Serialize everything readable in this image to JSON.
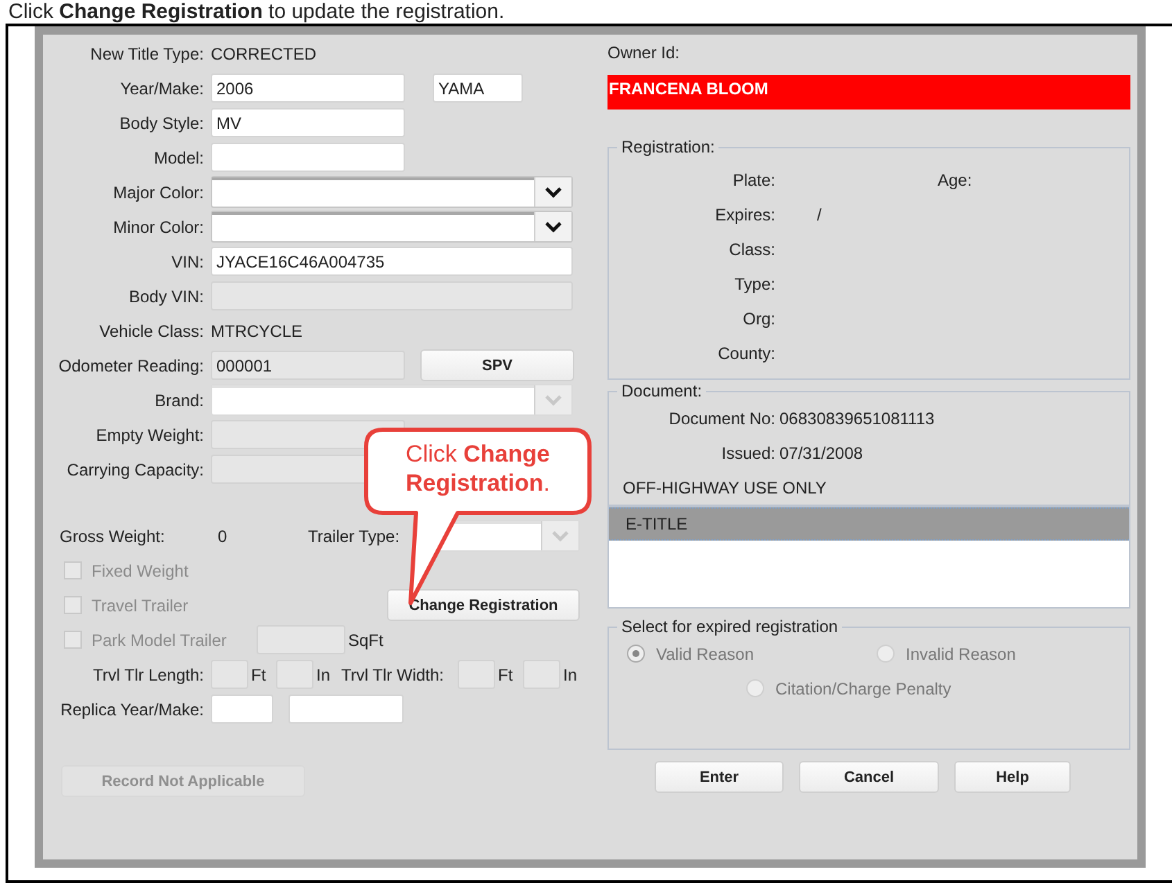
{
  "instruction": "Click **Change Registration** to update the registration.",
  "vehicle": {
    "fields": [
      {
        "kind": "static",
        "label": "New Title Type:",
        "value": "CORRECTED"
      },
      {
        "kind": "short_input",
        "label": "Year/Make:",
        "value": "2006",
        "extra_value": "YAMA"
      },
      {
        "kind": "short_input",
        "label": "Body Style:",
        "value": "MV"
      },
      {
        "kind": "short_input",
        "label": "Model:"
      },
      {
        "kind": "select",
        "label": "Major Color:",
        "disabled": false
      },
      {
        "kind": "select",
        "label": "Minor Color:",
        "disabled": false
      },
      {
        "kind": "long_input",
        "label": "VIN:",
        "value": "JYACE16C46A004735"
      },
      {
        "kind": "long_readonly",
        "label": "Body VIN:"
      },
      {
        "kind": "static",
        "label": "Vehicle Class:",
        "value": "MTRCYCLE"
      },
      {
        "kind": "short_readonly",
        "label": "Odometer Reading:",
        "value": "000001",
        "button": "SPV"
      },
      {
        "kind": "select",
        "label": "Brand:",
        "disabled": true
      },
      {
        "kind": "short_readonly",
        "label": "Empty Weight:"
      },
      {
        "kind": "short_readonly",
        "label": "Carrying Capacity:"
      }
    ],
    "gross_weight": {
      "label": "Gross Weight:",
      "value": "0"
    },
    "trailer_type": {
      "label": "Trailer Type:",
      "disabled": true
    },
    "checkboxes": [
      {
        "label": "Fixed Weight",
        "checked": false,
        "disabled": true
      },
      {
        "label": "Travel Trailer",
        "checked": false,
        "disabled": true
      },
      {
        "label": "Park Model Trailer",
        "checked": false,
        "disabled": true
      }
    ],
    "change_registration_button": "Change Registration",
    "sqft_unit": "SqFt",
    "trailer_length": {
      "label": "Trvl Tlr Length:",
      "feet_unit": "Ft",
      "inch_unit": "In"
    },
    "trailer_width": {
      "label": "Trvl Tlr Width:",
      "feet_unit": "Ft",
      "inch_unit": "In"
    },
    "replica": {
      "label": "Replica Year/Make:"
    },
    "record_not_applicable_button": {
      "label": "Record Not Applicable",
      "disabled": true
    }
  },
  "owner": {
    "label": "Owner Id:",
    "name": "FRANCENA BLOOM"
  },
  "registration": {
    "legend": "Registration:",
    "rows": [
      {
        "label": "Plate:",
        "second_label": "Age:"
      },
      {
        "label": "Expires:",
        "value": "/"
      },
      {
        "label": "Class:"
      },
      {
        "label": "Type:"
      },
      {
        "label": "Org:"
      },
      {
        "label": "County:"
      }
    ]
  },
  "document": {
    "legend": "Document:",
    "rows": [
      {
        "label": "Document No:",
        "value": "06830839651081113"
      },
      {
        "label": "Issued:",
        "value": "07/31/2008"
      }
    ],
    "note": "OFF-HIGHWAY USE ONLY"
  },
  "title_list": [
    {
      "text": "E-TITLE",
      "selected": true
    }
  ],
  "expired": {
    "legend": "Select for expired registration",
    "options": [
      {
        "label": "Valid Reason",
        "selected": true,
        "disabled": true
      },
      {
        "label": "Invalid Reason",
        "selected": false,
        "disabled": true
      },
      {
        "label": "Citation/Charge Penalty",
        "selected": false,
        "disabled": true
      }
    ]
  },
  "buttons": [
    "Enter",
    "Cancel",
    "Help"
  ],
  "callout": "Click **Change Registration**."
}
